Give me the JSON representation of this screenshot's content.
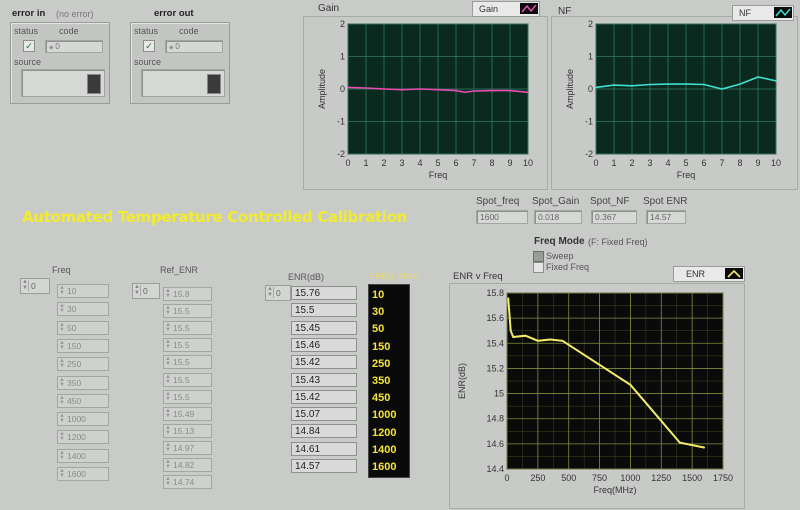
{
  "error_in": {
    "title": "error in",
    "subtitle": "(no error)",
    "status_label": "status",
    "code_label": "code",
    "code_value": "0",
    "source_label": "source"
  },
  "error_out": {
    "title": "error out",
    "status_label": "status",
    "code_label": "code",
    "code_value": "0",
    "source_label": "source"
  },
  "gain_graph": {
    "legend": "Gain",
    "ylabel": "Amplitude",
    "xlabel": "Freq",
    "legend_color": "#e84cb0"
  },
  "nf_graph": {
    "legend": "NF",
    "ylabel": "Amplitude",
    "xlabel": "Freq",
    "legend_color": "#3fe0d0"
  },
  "spot": {
    "freq_label": "Spot_freq",
    "freq_value": "1600",
    "gain_label": "Spot_Gain",
    "gain_value": "0.018",
    "nf_label": "Spot_NF",
    "nf_value": "0.367",
    "enr_label": "Spot ENR",
    "enr_value": "14.57"
  },
  "banner": "Automated Temperature Controlled Calibration",
  "freq_mode": {
    "label": "Freq Mode",
    "hint": "(F: Fixed Freq)",
    "options": [
      "Sweep",
      "Fixed Freq"
    ]
  },
  "freq_array": {
    "label": "Freq",
    "index": "0",
    "values": [
      "10",
      "30",
      "50",
      "150",
      "250",
      "350",
      "450",
      "1000",
      "1200",
      "1400",
      "1600"
    ]
  },
  "ref_enr_array": {
    "label": "Ref_ENR",
    "index": "0",
    "values": [
      "15.8",
      "15.5",
      "15.5",
      "15.5",
      "15.5",
      "15.5",
      "15.5",
      "15.49",
      "15.13",
      "14.97",
      "14.82",
      "14.74"
    ]
  },
  "enr_array": {
    "label": "ENR(dB)",
    "index": "0",
    "values": [
      "15.76",
      "15.5",
      "15.45",
      "15.46",
      "15.42",
      "15.43",
      "15.42",
      "15.07",
      "14.84",
      "14.61",
      "14.57"
    ]
  },
  "freq_column": {
    "label": "FREQ (MHz)",
    "values": [
      "10",
      "30",
      "50",
      "150",
      "250",
      "350",
      "450",
      "1000",
      "1200",
      "1400",
      "1600"
    ],
    "text_color": "#f4e53a"
  },
  "enr_graph": {
    "label": "ENR v Freq",
    "legend": "ENR",
    "legend_color": "#f2ec6a"
  },
  "chart_data": [
    {
      "type": "line",
      "title": "Gain",
      "xlabel": "Freq",
      "ylabel": "Amplitude",
      "xlim": [
        0,
        10
      ],
      "ylim": [
        -2,
        2
      ],
      "x_ticks": [
        "0",
        "1",
        "2",
        "3",
        "4",
        "5",
        "6",
        "7",
        "8",
        "9",
        "10"
      ],
      "y_ticks": [
        "-2",
        "-1",
        "0",
        "1",
        "2"
      ],
      "grid": true,
      "series": [
        {
          "name": "Gain",
          "color": "#e84cb0",
          "x": [
            0,
            1,
            2,
            3,
            4,
            5,
            6,
            6.5,
            7,
            8,
            9,
            10
          ],
          "y": [
            0.05,
            0.03,
            0.0,
            -0.02,
            0.0,
            -0.02,
            -0.05,
            -0.1,
            -0.06,
            -0.05,
            -0.05,
            -0.1
          ]
        }
      ]
    },
    {
      "type": "line",
      "title": "NF",
      "xlabel": "Freq",
      "ylabel": "Amplitude",
      "xlim": [
        0,
        10
      ],
      "ylim": [
        -2,
        2
      ],
      "x_ticks": [
        "0",
        "1",
        "2",
        "3",
        "4",
        "5",
        "6",
        "7",
        "8",
        "9",
        "10"
      ],
      "y_ticks": [
        "-2",
        "-1",
        "0",
        "1",
        "2"
      ],
      "grid": true,
      "series": [
        {
          "name": "NF",
          "color": "#3fe0d0",
          "x": [
            0,
            1,
            2,
            3,
            4,
            5,
            6,
            7,
            8,
            9,
            10
          ],
          "y": [
            0.05,
            0.12,
            0.1,
            0.14,
            0.15,
            0.15,
            0.14,
            0.0,
            0.15,
            0.37,
            0.25
          ]
        }
      ]
    },
    {
      "type": "line",
      "title": "ENR v Freq",
      "xlabel": "Freq(MHz)",
      "ylabel": "ENR(dB)",
      "xlim": [
        0,
        1750
      ],
      "ylim": [
        14.4,
        15.8
      ],
      "x_ticks": [
        "0",
        "250",
        "500",
        "750",
        "1000",
        "1250",
        "1500",
        "1750"
      ],
      "y_ticks": [
        "14.4",
        "14.6",
        "14.8",
        "15",
        "15.2",
        "15.4",
        "15.6",
        "15.8"
      ],
      "grid": true,
      "series": [
        {
          "name": "ENR",
          "color": "#f2ec6a",
          "x": [
            10,
            30,
            50,
            150,
            250,
            350,
            450,
            1000,
            1200,
            1400,
            1600
          ],
          "y": [
            15.76,
            15.5,
            15.45,
            15.46,
            15.42,
            15.43,
            15.42,
            15.07,
            14.84,
            14.61,
            14.57
          ]
        }
      ]
    }
  ]
}
